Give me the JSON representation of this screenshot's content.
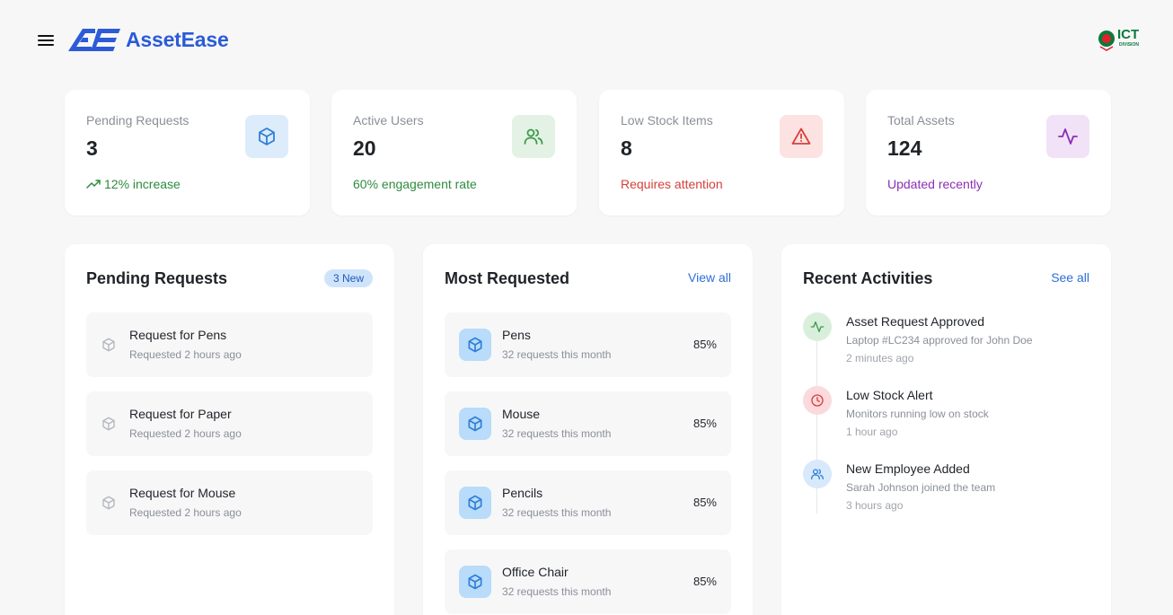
{
  "app": {
    "name": "AssetEase",
    "org_logo_text": "ICT",
    "org_logo_sub": "DIVISION"
  },
  "stats": [
    {
      "label": "Pending Requests",
      "value": "3",
      "foot": "12% increase",
      "foot_color": "#2e8b3e",
      "icon": "box-icon",
      "icon_bg": "#dcecfb",
      "icon_color": "#2f7fd6"
    },
    {
      "label": "Active Users",
      "value": "20",
      "foot": "60% engagement rate",
      "foot_color": "#2e8b3e",
      "icon": "users-icon",
      "icon_bg": "#e3f2e4",
      "icon_color": "#3c9a4a"
    },
    {
      "label": "Low Stock Items",
      "value": "8",
      "foot": "Requires attention",
      "foot_color": "#d6403a",
      "icon": "alert-triangle-icon",
      "icon_bg": "#fde2e2",
      "icon_color": "#d6403a"
    },
    {
      "label": "Total Assets",
      "value": "124",
      "foot": "Updated recently",
      "foot_color": "#8b2fb3",
      "icon": "activity-icon",
      "icon_bg": "#f1e2f7",
      "icon_color": "#8b2fb3"
    }
  ],
  "pending": {
    "title": "Pending Requests",
    "badge": "3 New",
    "items": [
      {
        "title": "Request for Pens",
        "time": "Requested 2 hours ago"
      },
      {
        "title": "Request for Paper",
        "time": "Requested 2 hours ago"
      },
      {
        "title": "Request for Mouse",
        "time": "Requested 2 hours ago"
      }
    ]
  },
  "most_requested": {
    "title": "Most Requested",
    "link": "View all",
    "items": [
      {
        "name": "Pens",
        "sub": "32 requests this month",
        "pct": "85%"
      },
      {
        "name": "Mouse",
        "sub": "32 requests this month",
        "pct": "85%"
      },
      {
        "name": "Pencils",
        "sub": "32 requests this month",
        "pct": "85%"
      },
      {
        "name": "Office Chair",
        "sub": "32 requests this month",
        "pct": "85%"
      }
    ]
  },
  "activities": {
    "title": "Recent Activities",
    "link": "See all",
    "items": [
      {
        "title": "Asset Request Approved",
        "desc": "Laptop #LC234 approved for John Doe",
        "time": "2 minutes ago",
        "icon": "activity-icon",
        "bg": "#d9efdc",
        "color": "#3c9a4a"
      },
      {
        "title": "Low Stock Alert",
        "desc": "Monitors running low on stock",
        "time": "1 hour ago",
        "icon": "clock-icon",
        "bg": "#fbd9dc",
        "color": "#d6403a"
      },
      {
        "title": "New Employee Added",
        "desc": "Sarah Johnson joined the team",
        "time": "3 hours ago",
        "icon": "users-icon",
        "bg": "#d7e9fb",
        "color": "#2f7fd6"
      }
    ]
  }
}
